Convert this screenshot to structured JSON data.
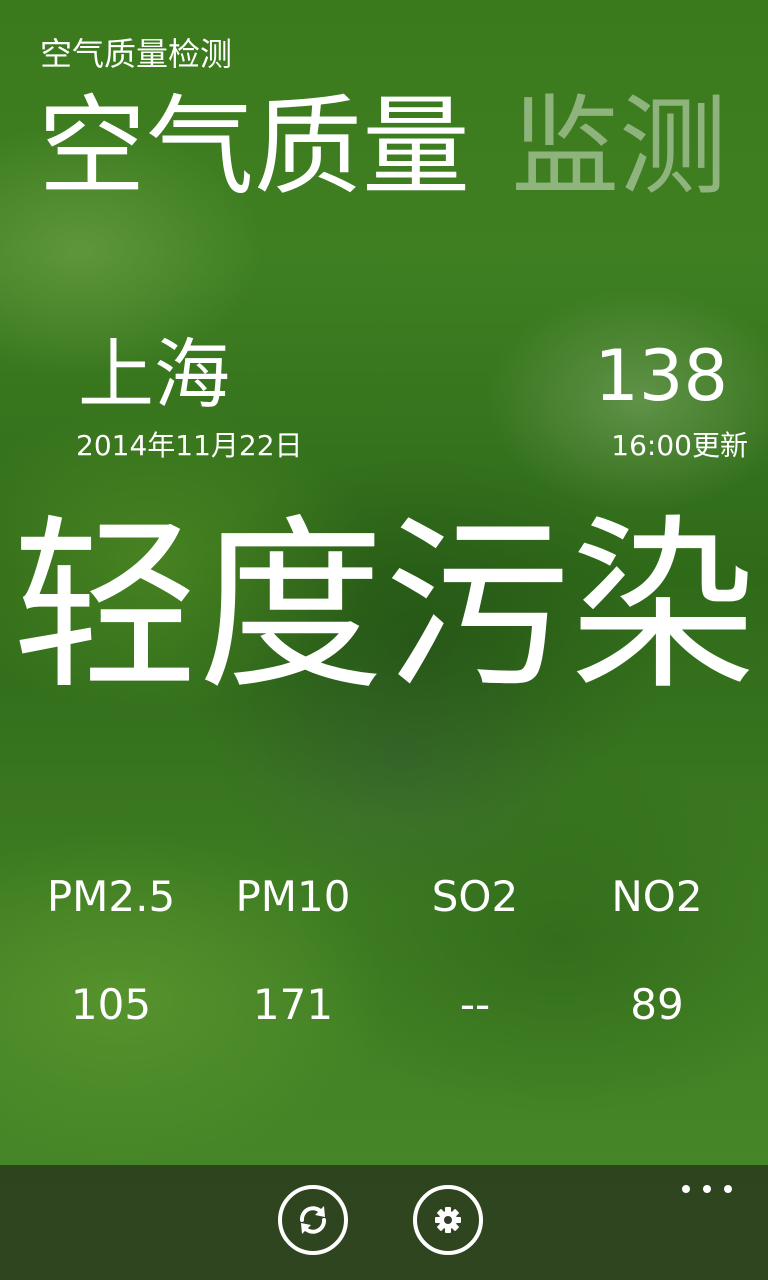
{
  "app": {
    "title": "空气质量检测"
  },
  "pivot": {
    "items": [
      {
        "label": "空气质量",
        "active": true
      },
      {
        "label": "监测",
        "active": false
      }
    ]
  },
  "current": {
    "city": "上海",
    "date": "2014年11月22日",
    "aqi": "138",
    "updated": "16:00更新",
    "level": "轻度污染"
  },
  "pollutants": [
    {
      "name": "PM2.5",
      "value": "105"
    },
    {
      "name": "PM10",
      "value": "171"
    },
    {
      "name": "SO2",
      "value": "--"
    },
    {
      "name": "NO2",
      "value": "89"
    }
  ],
  "appbar": {
    "buttons": [
      {
        "icon": "refresh-icon"
      },
      {
        "icon": "gear-icon"
      }
    ],
    "more_icon": "more-dots-icon"
  },
  "colors": {
    "background": "#3f7a1f",
    "text": "#ffffff",
    "appbar": "#28321e"
  }
}
